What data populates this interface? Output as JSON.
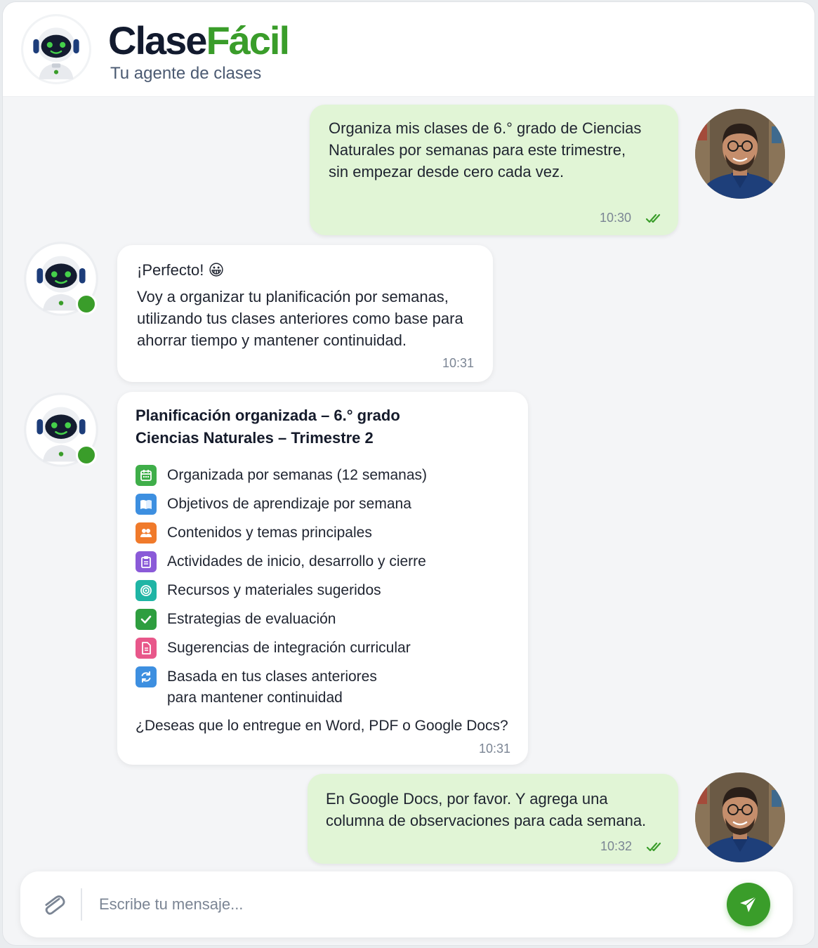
{
  "header": {
    "brand_part1": "Clase",
    "brand_part2": "Fácil",
    "tagline": "Tu agente de clases"
  },
  "colors": {
    "brand_green": "#3a9d2a",
    "brand_dark": "#121a2e",
    "user_bubble": "#e1f5d6",
    "bot_bubble": "#ffffff"
  },
  "messages": [
    {
      "sender": "user",
      "text": "Organiza mis clases de 6.° grado de Ciencias Naturales por semanas para este trimestre, sin empezar desde cero cada vez.",
      "time": "10:30",
      "status": "read"
    },
    {
      "sender": "bot",
      "greeting": "¡Perfecto! 😀",
      "text": "Voy a organizar tu planificación por semanas, utilizando tus clases anteriores como base para ahorrar tiempo y mantener continuidad.",
      "time": "10:31"
    },
    {
      "sender": "bot",
      "title_line1": "Planificación organizada – 6.° grado",
      "title_line2": "Ciencias Naturales – Trimestre 2",
      "items": [
        {
          "icon": "calendar-icon",
          "color": "#3fae49",
          "label": "Organizada por semanas (12 semanas)"
        },
        {
          "icon": "book-icon",
          "color": "#3d8fe0",
          "label": "Objetivos de aprendizaje por semana"
        },
        {
          "icon": "people-icon",
          "color": "#f07a2b",
          "label": "Contenidos y temas principales"
        },
        {
          "icon": "clipboard-icon",
          "color": "#8a5ad8",
          "label": "Actividades de inicio, desarrollo y cierre"
        },
        {
          "icon": "target-icon",
          "color": "#1fb5a5",
          "label": "Recursos y materiales sugeridos"
        },
        {
          "icon": "check-icon",
          "color": "#2e9e3f",
          "label": "Estrategias de evaluación"
        },
        {
          "icon": "document-icon",
          "color": "#e8578a",
          "label": "Sugerencias de integración curricular"
        },
        {
          "icon": "refresh-icon",
          "color": "#3d8fe0",
          "label": "Basada en tus clases anteriores",
          "label2": "para mantener continuidad"
        }
      ],
      "question": "¿Deseas que lo entregue en Word, PDF o Google Docs?",
      "time": "10:31"
    },
    {
      "sender": "user",
      "text": "En Google Docs, por favor. Y agrega una columna de observaciones para cada semana.",
      "time": "10:32",
      "status": "read"
    }
  ],
  "composer": {
    "placeholder": "Escribe tu mensaje...",
    "value": ""
  }
}
